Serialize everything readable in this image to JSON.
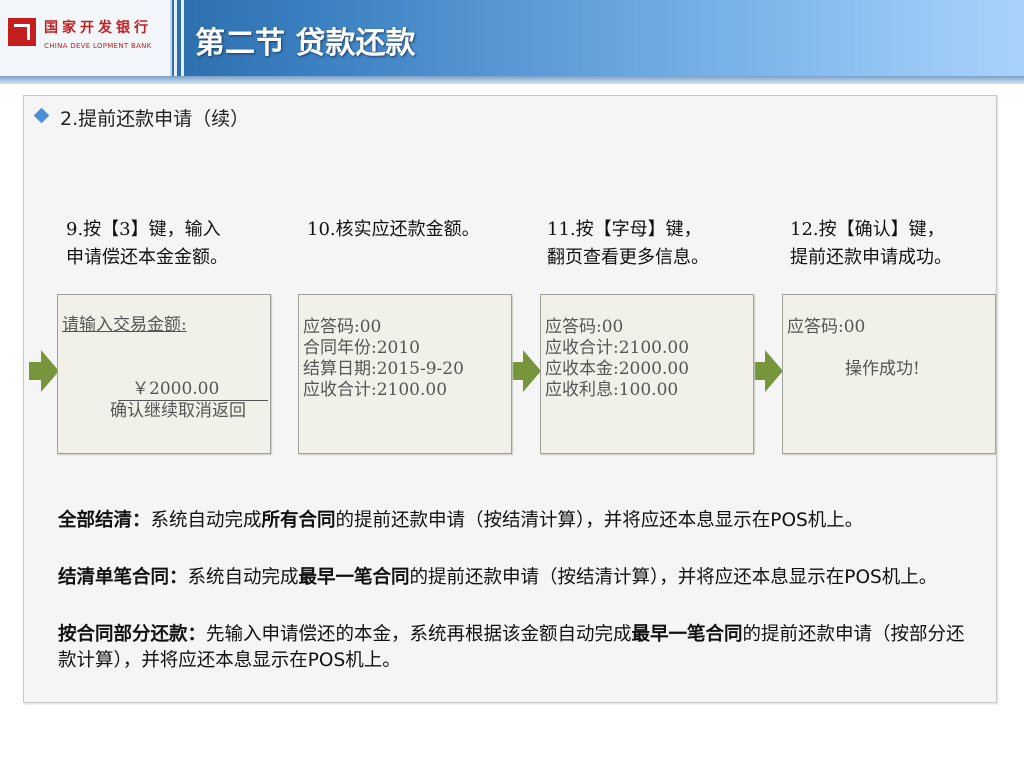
{
  "header": {
    "logo_cn": "国家开发银行",
    "logo_en": "CHINA DEVE LOPMENT BANK",
    "title": "第二节 贷款还款"
  },
  "subtitle": "2.提前还款申请（续）",
  "steps": [
    {
      "caption_line1": "9.按【3】键，输入",
      "caption_line2": "申请偿还本金金额。"
    },
    {
      "caption_line1": "10.核实应还款金额。",
      "caption_line2": ""
    },
    {
      "caption_line1": "11.按【字母】键，",
      "caption_line2": "翻页查看更多信息。"
    },
    {
      "caption_line1": "12.按【确认】键，",
      "caption_line2": "提前还款申请成功。"
    }
  ],
  "screens": [
    {
      "prompt": "请输入交易金额:",
      "amount": "￥2000.00",
      "footer": "确认继续取消返回"
    },
    {
      "lines": [
        "应答码:00",
        "合同年份:2010",
        "结算日期:2015-9-20",
        "应收合计:2100.00"
      ]
    },
    {
      "lines": [
        "应答码:00",
        "应收合计:2100.00",
        "应收本金:2000.00",
        "应收利息:100.00"
      ]
    },
    {
      "line1": "应答码:00",
      "message": "操作成功!"
    }
  ],
  "paragraphs": [
    {
      "lead": "全部结清：",
      "t1": "系统自动完成",
      "bold": "所有合同",
      "t2": "的提前还款申请（按结清计算），并将应还本息显示在POS机上。"
    },
    {
      "lead": "结清单笔合同：",
      "t1": "系统自动完成",
      "bold": "最早一笔合同",
      "t2": "的提前还款申请（按结清计算），并将应还本息显示在POS机上。"
    },
    {
      "lead": "按合同部分还款：",
      "t1": "先输入申请偿还的本金，系统再根据该金额自动完成",
      "bold": "最早一笔合同",
      "t2": "的提前还款申请（按部分还款计算），并将应还本息显示在POS机上。"
    }
  ],
  "colors": {
    "arrow": "#77953a",
    "header_start": "#1d5a93",
    "header_end": "#a9d3fb",
    "logo_red": "#c41e1e"
  }
}
